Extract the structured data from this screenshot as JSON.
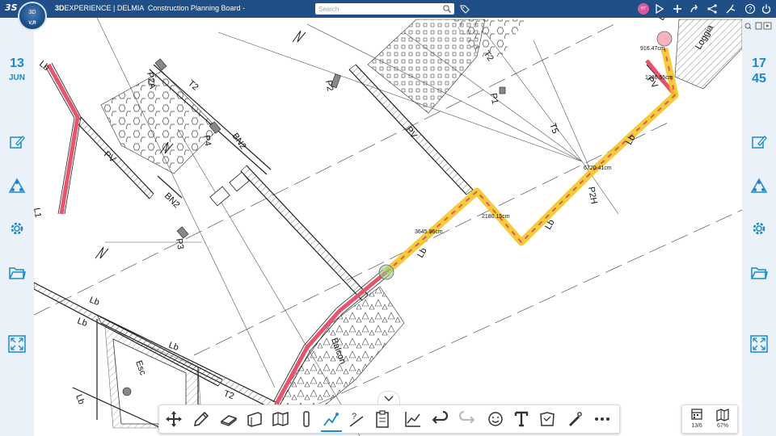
{
  "topbar": {
    "brand_bold": "3D",
    "brand_rest": "EXPERIENCE | DELMIA",
    "app_name": "Construction Planning Board -",
    "compass_top": "3D",
    "compass_bottom": "V,R",
    "search_placeholder": "Search",
    "avatar_initials": "HT"
  },
  "left_panel": {
    "date_day": "13",
    "date_month": "JUN"
  },
  "right_panel": {
    "time_hour": "17",
    "time_minute": "45"
  },
  "drawing": {
    "labels": [
      "Lb",
      "P2A",
      "T2",
      "P4",
      "BN2",
      "PV",
      "BN2",
      "P3",
      "L1",
      "P2",
      "PV",
      "P1",
      "T5",
      "T2",
      "P2H",
      "Lb",
      "Lb",
      "Lb",
      "Esc",
      "Lb",
      "T2",
      "Balcon",
      "Loggia",
      "PV",
      "Lb",
      "Lb",
      "Lb",
      "Lb"
    ],
    "measure_1": "916.47cm",
    "measure_2": "1236.55cm",
    "measure_3": "6720.41cm",
    "measure_4": "2180.15cm",
    "measure_5": "3645.86cm"
  },
  "status": {
    "calendar_value": "13/6",
    "zoom_value": "67%"
  },
  "colors": {
    "topbar": "#1f4f86",
    "accent": "#1b8ac9",
    "panel": "#eaf1f8",
    "path_highlight": "#f0c419",
    "path_red": "#e8536e"
  }
}
